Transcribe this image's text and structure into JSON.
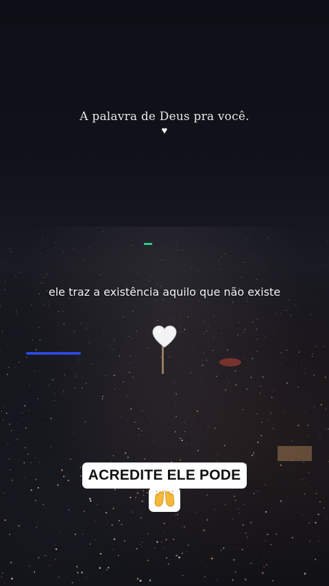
{
  "top_caption": "A palavra de Deus pra você.",
  "top_heart_glyph": "♥",
  "middle_caption": "ele traz a existência aquilo que não existe",
  "heart_icon": "white-heart-icon",
  "sticker_text": "ACREDITE ELE PODE",
  "emoji_icon": "raising-hands-icon",
  "colors": {
    "sky": "#0d0f16",
    "city_light_warm": "#e8b070",
    "city_light_cool": "#d9dbe6",
    "accent_blue": "#3050ff",
    "accent_green": "#2ce08a",
    "accent_red": "#e04a3a",
    "sticker_bg": "#ffffff",
    "sticker_text": "#111111"
  }
}
